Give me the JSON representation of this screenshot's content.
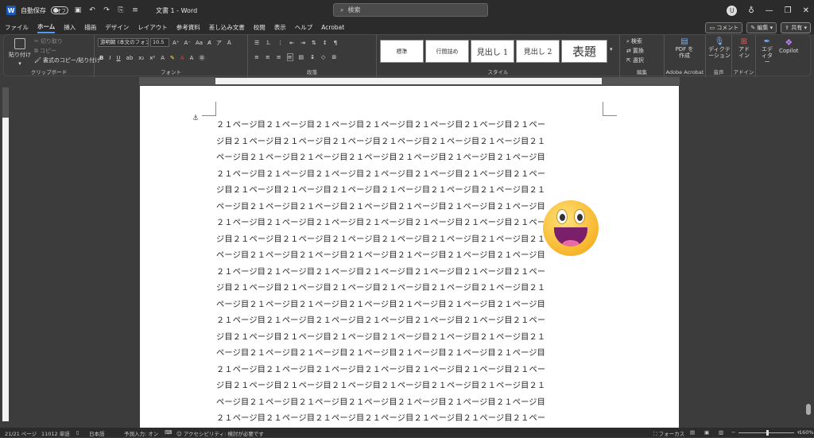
{
  "titlebar": {
    "autosave_label": "自動保存",
    "autosave_state": "オフ",
    "doc_title": "文書 1  -  Word",
    "search_placeholder": "検索",
    "avatar_initial": "U"
  },
  "menubar": {
    "tabs": [
      "ファイル",
      "ホーム",
      "挿入",
      "描画",
      "デザイン",
      "レイアウト",
      "参考資料",
      "差し込み文書",
      "校閲",
      "表示",
      "ヘルプ",
      "Acrobat"
    ],
    "active_tab": "ホーム",
    "comment_label": "コメント",
    "edit_label": "編集",
    "share_label": "共有"
  },
  "ribbon": {
    "clipboard": {
      "paste_label": "貼り付け",
      "cut_label": "切り取り",
      "copy_label": "コピー",
      "format_painter_label": "書式のコピー/貼り付け",
      "group_label": "クリップボード"
    },
    "font": {
      "font_name": "游明朝 (本文のフォン",
      "font_size": "10.5",
      "group_label": "フォント"
    },
    "paragraph": {
      "group_label": "段落"
    },
    "styles": {
      "items": [
        "標準",
        "行間詰め",
        "見出し 1",
        "見出し 2",
        "表題"
      ],
      "group_label": "スタイル"
    },
    "editing": {
      "find_label": "検索",
      "replace_label": "置換",
      "select_label": "選択",
      "group_label": "編集"
    },
    "acrobat": {
      "button_label": "PDF を作成",
      "group_label": "Adobe Acrobat"
    },
    "voice": {
      "button_label": "ディクテーション",
      "group_label": "音声"
    },
    "addins": {
      "button_label": "アド イン",
      "group_label": "アドイン"
    },
    "editor": {
      "button_label": "エディター"
    },
    "copilot": {
      "button_label": "Copilot"
    }
  },
  "document": {
    "lines": [
      "２１ページ目２１ページ目２１ページ目２１ページ目２１ページ目２１ページ目２１ペー",
      "ジ目２１ページ目２１ページ目２１ページ目２１ページ目２１ページ目２１ページ目２１",
      "ページ目２１ページ目２１ページ目２１ページ目２１ページ目２１ページ目２１ページ目",
      "２１ページ目２１ページ目２１ページ目２１ページ目２１ページ目２１ページ目２１ペー",
      "ジ目２１ページ目２１ページ目２１ページ目２１ページ目２１ページ目２１ページ目２１",
      "ページ目２１ページ目２１ページ目２１ページ目２１ページ目２１ページ目２１ページ目",
      "２１ページ目２１ページ目２１ページ目２１ページ目２１ページ目２１ページ目２１ペー",
      "ジ目２１ページ目２１ページ目２１ページ目２１ページ目２１ページ目２１ページ目２１",
      "ページ目２１ページ目２１ページ目２１ページ目２１ページ目２１ページ目２１ページ目",
      "２１ページ目２１ページ目２１ページ目２１ページ目２１ページ目２１ページ目２１ペー",
      "ジ目２１ページ目２１ページ目２１ページ目２１ページ目２１ページ目２１ページ目２１",
      "ページ目２１ページ目２１ページ目２１ページ目２１ページ目２１ページ目２１ページ目",
      "２１ページ目２１ページ目２１ページ目２１ページ目２１ページ目２１ページ目２１ペー",
      "ジ目２１ページ目２１ページ目２１ページ目２１ページ目２１ページ目２１ページ目２１",
      "ページ目２１ページ目２１ページ目２１ページ目２１ページ目２１ページ目２１ページ目",
      "２１ページ目２１ページ目２１ページ目２１ページ目２１ページ目２１ページ目２１ペー",
      "ジ目２１ページ目２１ページ目２１ページ目２１ページ目２１ページ目２１ページ目２１",
      "ページ目２１ページ目２１ページ目２１ページ目２１ページ目２１ページ目２１ページ目",
      "２１ページ目２１ページ目２１ページ目２１ページ目２１ページ目２１ページ目２１ペー"
    ]
  },
  "statusbar": {
    "page": "21/21 ページ",
    "words": "11012 単語",
    "language": "日本語",
    "predictive": "予測入力: オン",
    "accessibility": "アクセシビリティ: 検討が必要です",
    "focus": "フォーカス",
    "zoom": "160%"
  },
  "colors": {
    "accent": "#4f9cf0",
    "word_brand": "#185abd"
  }
}
